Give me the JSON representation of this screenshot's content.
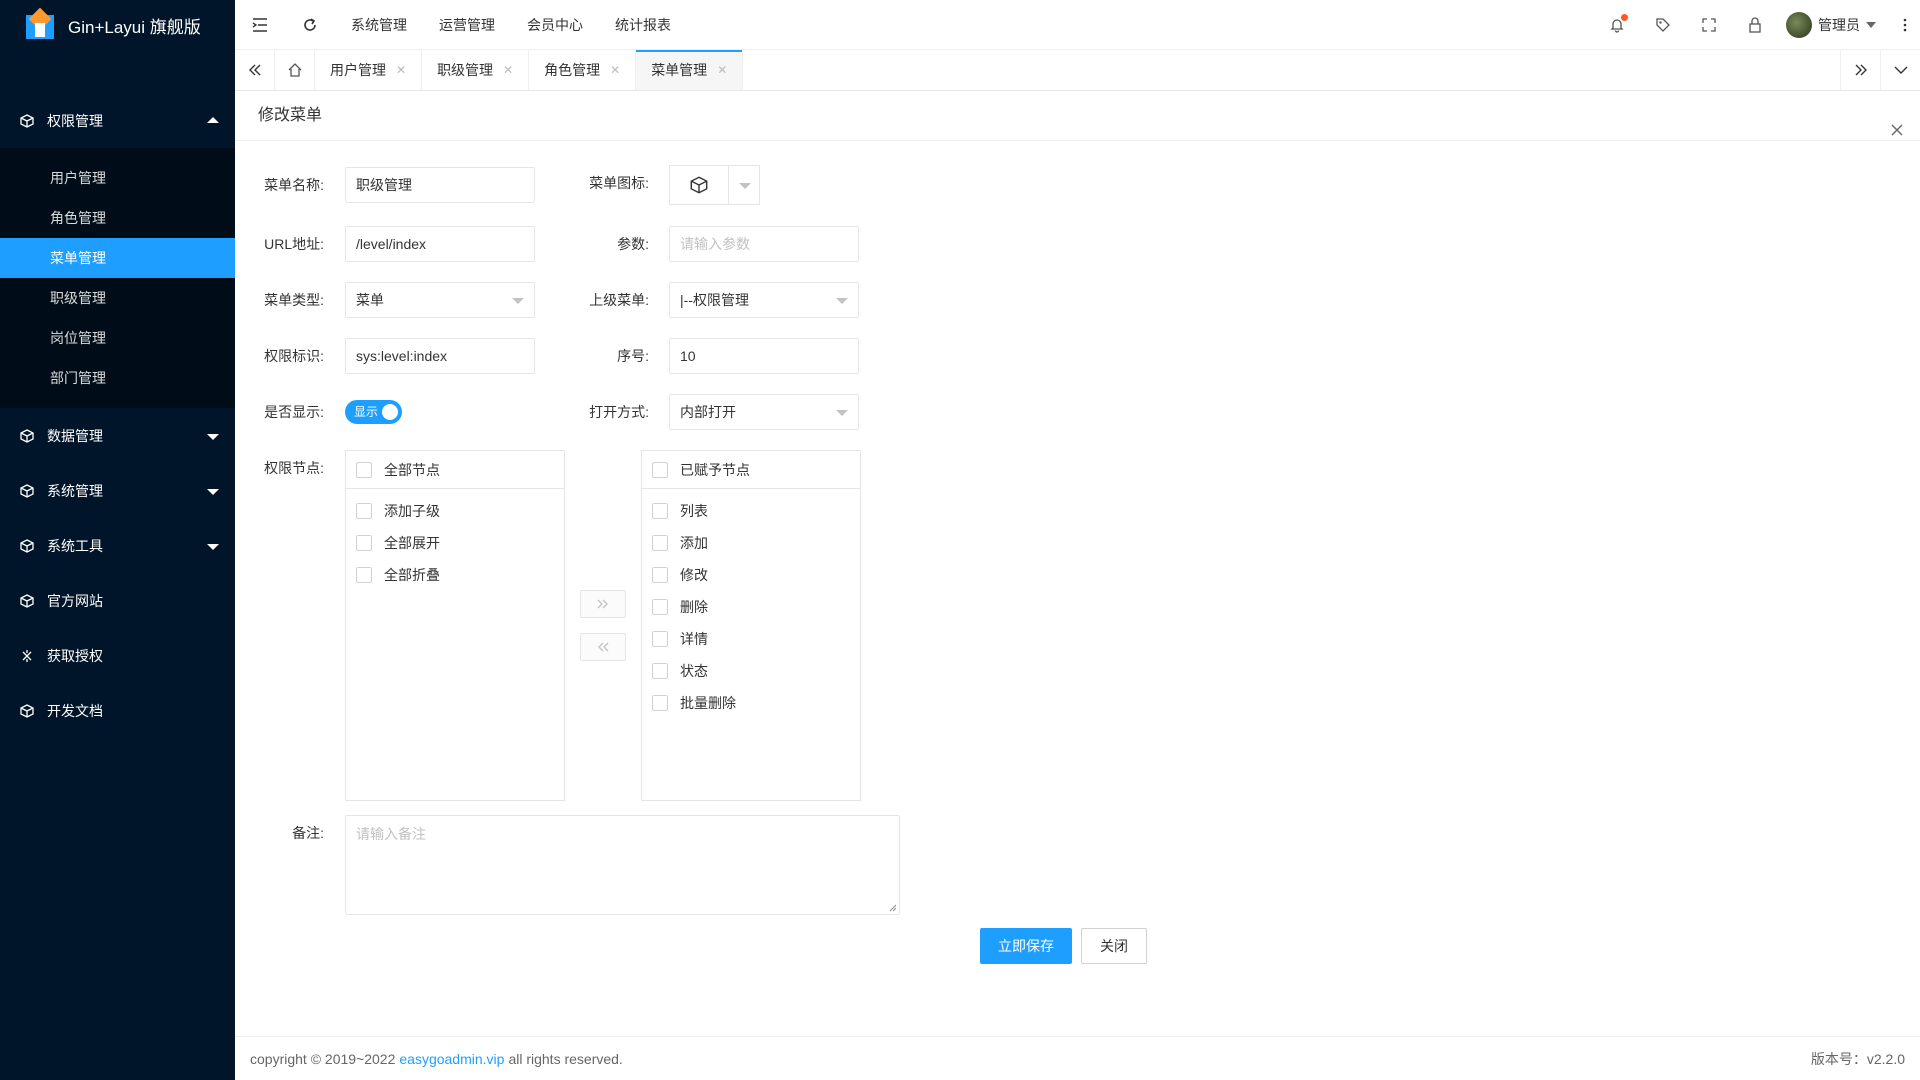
{
  "app": {
    "title": "Gin+Layui 旗舰版"
  },
  "sidebar": {
    "groups": [
      {
        "label": "权限管理",
        "icon": "cube-icon",
        "expanded": true
      },
      {
        "label": "数据管理",
        "icon": "cube-icon"
      },
      {
        "label": "系统管理",
        "icon": "cube-icon"
      },
      {
        "label": "系统工具",
        "icon": "cube-icon"
      },
      {
        "label": "官方网站",
        "icon": "cube-icon"
      },
      {
        "label": "获取授权",
        "icon": "sparkle-icon"
      },
      {
        "label": "开发文档",
        "icon": "cube-icon"
      }
    ],
    "submenu": [
      "用户管理",
      "角色管理",
      "菜单管理",
      "职级管理",
      "岗位管理",
      "部门管理"
    ],
    "active_submenu": "菜单管理"
  },
  "header": {
    "nav": [
      "系统管理",
      "运营管理",
      "会员中心",
      "统计报表"
    ],
    "user_name": "管理员"
  },
  "tabs": {
    "items": [
      "用户管理",
      "职级管理",
      "角色管理",
      "菜单管理"
    ],
    "active": "菜单管理"
  },
  "panel": {
    "title": "修改菜单"
  },
  "form": {
    "name_label": "菜单名称:",
    "name_value": "职级管理",
    "icon_label": "菜单图标:",
    "url_label": "URL地址:",
    "url_value": "/level/index",
    "param_label": "参数:",
    "param_placeholder": "请输入参数",
    "type_label": "菜单类型:",
    "type_value": "菜单",
    "parent_label": "上级菜单:",
    "parent_value": "|--权限管理",
    "perm_label": "权限标识:",
    "perm_value": "sys:level:index",
    "sort_label": "序号:",
    "sort_value": "10",
    "show_label": "是否显示:",
    "show_value": "显示",
    "open_label": "打开方式:",
    "open_value": "内部打开",
    "nodes_label": "权限节点:",
    "left_title": "全部节点",
    "left_items": [
      "添加子级",
      "全部展开",
      "全部折叠"
    ],
    "right_title": "已赋予节点",
    "right_items": [
      "列表",
      "添加",
      "修改",
      "删除",
      "详情",
      "状态",
      "批量删除"
    ],
    "note_label": "备注:",
    "note_placeholder": "请输入备注",
    "save_label": "立即保存",
    "close_label": "关闭"
  },
  "footer": {
    "copyright_prefix": "copyright © 2019~2022",
    "link": "easygoadmin.vip",
    "copyright_suffix": "all rights reserved.",
    "version": "版本号：v2.2.0"
  },
  "colors": {
    "sidebar_bg": "#001529",
    "accent": "#1e9fff",
    "badge": "#ff5722"
  }
}
